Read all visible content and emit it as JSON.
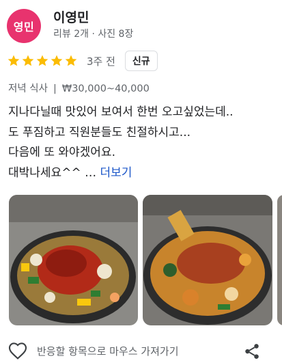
{
  "reviewer": {
    "avatar_text": "영민",
    "name": "이영민",
    "meta": "리뷰 2개 · 사진 8장"
  },
  "rating": {
    "stars": 5,
    "max_stars": 5,
    "time_ago": "3주 전",
    "badge": "신규"
  },
  "details": {
    "meal": "저녁 식사",
    "separator": "|",
    "price": "₩30,000~40,000"
  },
  "review": {
    "lines": [
      "지나다닐때 맛있어 보여서 한번 오고싶었는데..",
      "도 푸짐하고 직원분들도 친절하시고...",
      "다음에 또 와야겠어요.",
      "대박나세요^^ … "
    ],
    "more_label": "더보기"
  },
  "photos": {
    "items": [
      {
        "icon": "food-photo"
      },
      {
        "icon": "food-photo"
      },
      {
        "icon": "food-photo"
      }
    ]
  },
  "footer": {
    "like_icon": "heart-outline-icon",
    "hover_label": "반응할 항목으로 마우스 가져가기",
    "share_icon": "share-icon"
  },
  "colors": {
    "avatar": "#e8336e",
    "star": "#fbbc04",
    "link": "#1a55c8",
    "muted_text": "#5f6368"
  }
}
